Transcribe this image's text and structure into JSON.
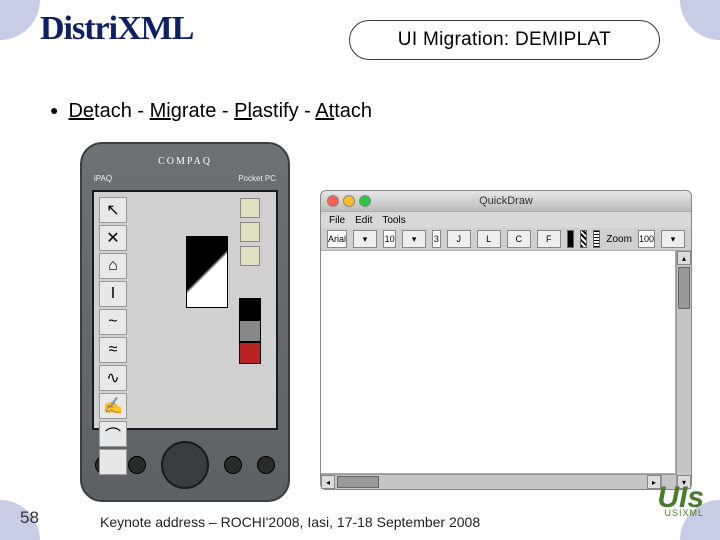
{
  "logo": "DistriXML",
  "title": "UI Migration: DEMIPLAT",
  "bullet": {
    "de": "De",
    "tach": "tach",
    "sep1": " - ",
    "mi": "Mi",
    "grate": "grate",
    "sep2": " - ",
    "pl": "Pl",
    "astify": "astify",
    "sep3": " - ",
    "at": "At",
    "tach2": "tach"
  },
  "pda": {
    "brand": "COMPAQ",
    "sub_left": "iPAQ",
    "sub_right": "Pocket PC",
    "tools": [
      "↖",
      "✕",
      "⌂",
      "I",
      "~",
      "≈",
      "∿",
      "✍",
      "⌒",
      " "
    ]
  },
  "quickdraw": {
    "title": "QuickDraw",
    "menu": [
      "File",
      "Edit",
      "Tools"
    ],
    "toolbar": {
      "font_label": "Arial",
      "size": "10",
      "extra": "3",
      "btns": [
        "J",
        "L",
        "C",
        "F"
      ],
      "zoom_label": "Zoom",
      "zoom_value": "100"
    }
  },
  "page_number": "58",
  "footer": "Keynote address – ROCHI'2008, Iasi, 17-18 September 2008",
  "right_logo": {
    "big": "UIs",
    "small": "USIXML"
  }
}
